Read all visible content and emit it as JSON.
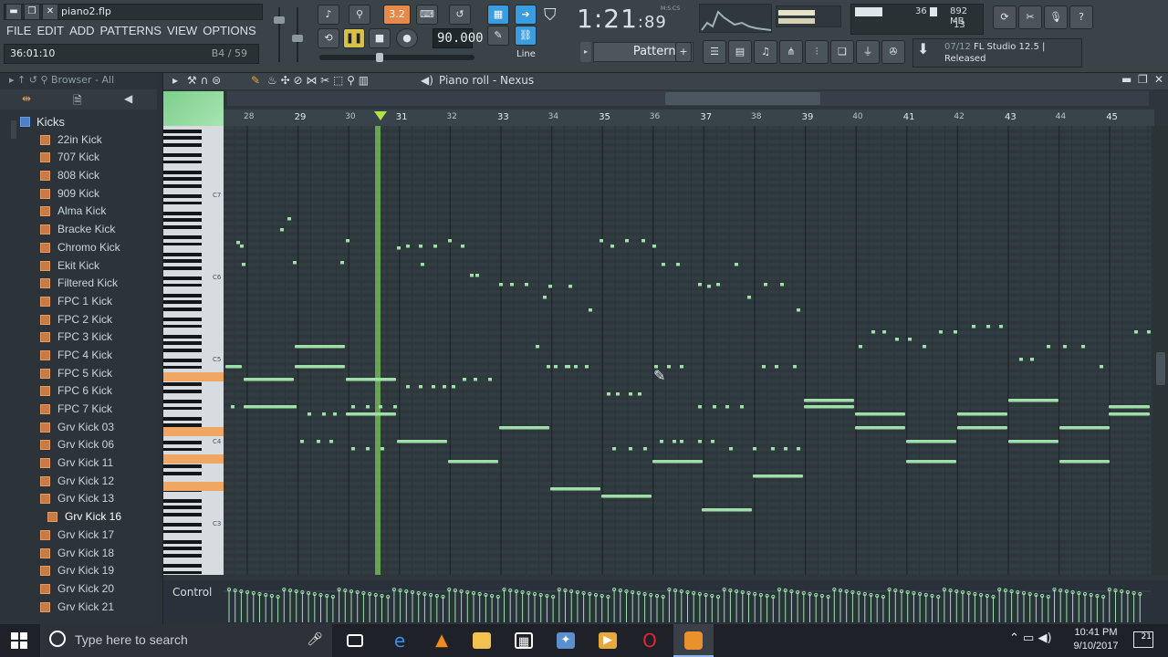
{
  "window": {
    "filename": "piano2.flp",
    "hint_left": "36:01:10",
    "hint_right": "B4 / 59"
  },
  "menu": [
    "FILE",
    "EDIT",
    "ADD",
    "PATTERNS",
    "VIEW",
    "OPTIONS",
    "TOOLS",
    "?"
  ],
  "transport": {
    "tempo": "90.000",
    "time": "1:21",
    "time_small": "89",
    "time_unit": "M:S:CS",
    "mode_pat": "3.2",
    "snap": "Line",
    "pattern": "Pattern 1"
  },
  "meters": {
    "memory": "892 MB",
    "cpu": "36",
    "polyphony": "13"
  },
  "news": {
    "date": "07/12",
    "text": "FL Studio 12.5 | Released"
  },
  "browser": {
    "header": "Browser - All",
    "folder": "Kicks",
    "items": [
      "22in Kick",
      "707 Kick",
      "808 Kick",
      "909 Kick",
      "Alma Kick",
      "Bracke Kick",
      "Chromo Kick",
      "Ekit Kick",
      "Filtered Kick",
      "FPC 1 Kick",
      "FPC 2 Kick",
      "FPC 3 Kick",
      "FPC 4 Kick",
      "FPC 5 Kick",
      "FPC 6 Kick",
      "FPC 7 Kick",
      "Grv Kick 03",
      "Grv Kick 06",
      "Grv Kick 11",
      "Grv Kick 12",
      "Grv Kick 13"
    ],
    "selected": "Grv Kick 16",
    "items_after": [
      "Grv Kick 17",
      "Grv Kick 18",
      "Grv Kick 19",
      "Grv Kick 20",
      "Grv Kick 21"
    ]
  },
  "piano_roll": {
    "title": "Piano roll - Nexus",
    "bars": [
      "28",
      "29",
      "30",
      "31",
      "32",
      "33",
      "34",
      "35",
      "36",
      "37",
      "38",
      "39",
      "40",
      "41",
      "42",
      "43",
      "44",
      "45"
    ],
    "octaves": [
      "C7",
      "C6",
      "C5",
      "C4",
      "C3"
    ],
    "control_label": "Control"
  },
  "taskbar": {
    "search_placeholder": "Type here to search",
    "time": "10:41 PM",
    "date": "9/10/2017",
    "notifications": "21"
  },
  "colors": {
    "note": "#9fe0a9",
    "playhead": "#7fd05a",
    "accent": "#e8894c"
  }
}
